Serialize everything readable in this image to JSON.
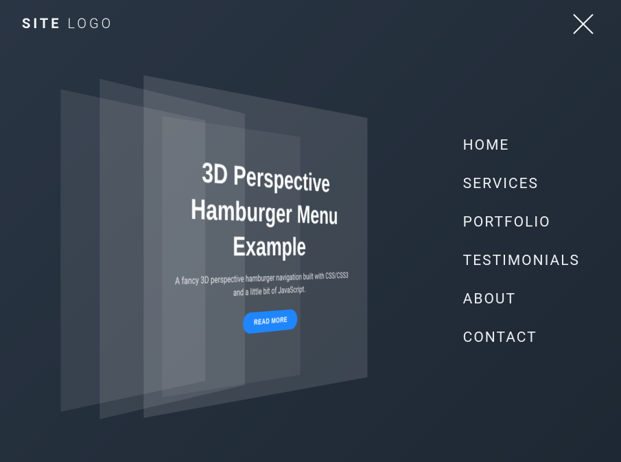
{
  "logo": {
    "part1": "SITE",
    "part2": "LOGO"
  },
  "hero": {
    "title": "3D Perspective Hamburger Menu Example",
    "subtitle": "A fancy 3D perspective hamburger navigation built with CSS/CSS3 and a little bit of JavaScript.",
    "cta": "READ MORE"
  },
  "nav": {
    "items": [
      "HOME",
      "SERVICES",
      "PORTFOLIO",
      "TESTIMONIALS",
      "ABOUT",
      "CONTACT"
    ]
  }
}
